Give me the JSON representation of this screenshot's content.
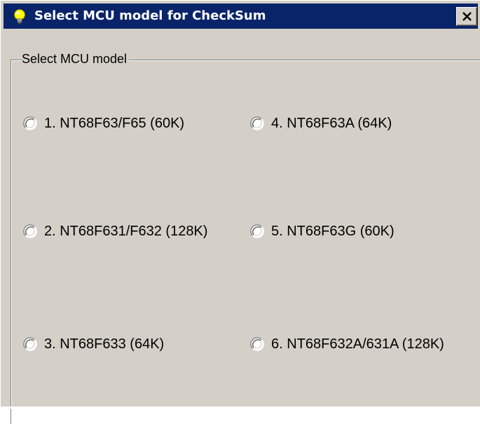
{
  "window": {
    "title": "Select MCU model for CheckSum",
    "close_symbol": "X",
    "title_icon": "lightbulb-icon"
  },
  "group": {
    "label": "Select MCU model"
  },
  "options": [
    {
      "label": "1. NT68F63/F65 (60K)",
      "selected": false
    },
    {
      "label": "2. NT68F631/F632 (128K)",
      "selected": false
    },
    {
      "label": "3. NT68F633 (64K)",
      "selected": false
    },
    {
      "label": "4. NT68F63A (64K)",
      "selected": false
    },
    {
      "label": "5. NT68F63G (60K)",
      "selected": false
    },
    {
      "label": "6. NT68F632A/631A (128K)",
      "selected": false
    }
  ],
  "colors": {
    "titlebar": "#0a246a",
    "face": "#d4d0c8",
    "icon_yellow": "#ffff00"
  }
}
